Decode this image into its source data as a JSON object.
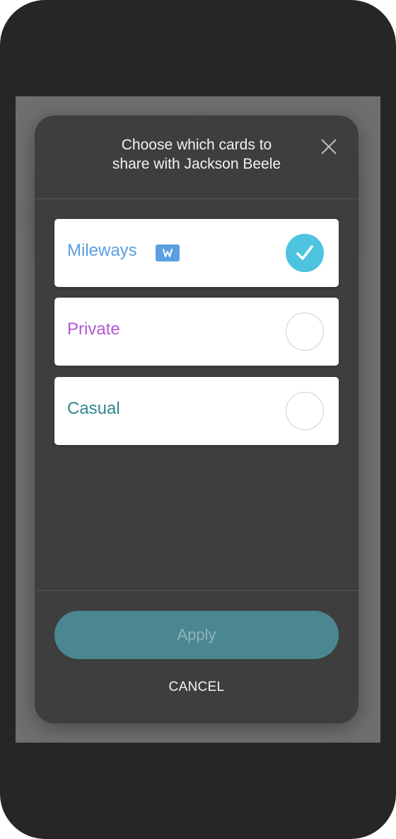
{
  "dialog": {
    "title": "Choose which cards to\nshare with Jackson Beele",
    "close_icon": "close-icon"
  },
  "cards": [
    {
      "label": "Mileways",
      "color": "#5a9fe0",
      "badge": "W",
      "badge_color": "#5a9fe0",
      "selected": true
    },
    {
      "label": "Private",
      "color": "#b356d6",
      "selected": false
    },
    {
      "label": "Casual",
      "color": "#33868f",
      "selected": false
    }
  ],
  "actions": {
    "apply_label": "Apply",
    "cancel_label": "CANCEL"
  },
  "colors": {
    "accent_check": "#4ec3e0",
    "apply_button": "#4b8790",
    "dialog_background": "#3e3e3e",
    "overlay": "#6f6f6f"
  }
}
